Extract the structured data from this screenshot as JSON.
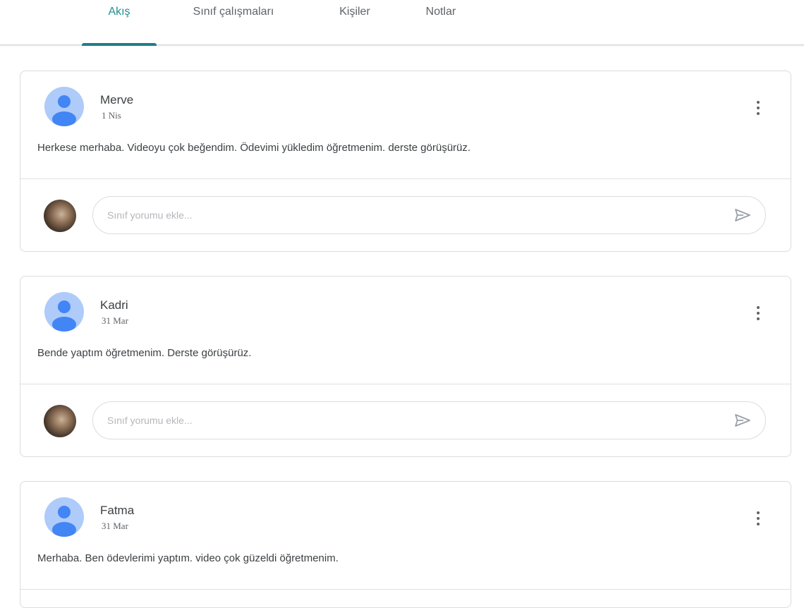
{
  "nav": {
    "tabs": [
      {
        "label": "Akış"
      },
      {
        "label": "Sınıf çalışmaları"
      },
      {
        "label": "Kişiler"
      },
      {
        "label": "Notlar"
      }
    ],
    "active_tab": "Akış",
    "accent_color": "#1e7f86"
  },
  "posts": [
    {
      "author": "Merve",
      "date": "1 Nis",
      "text": "Herkese merhaba. Videoyu çok beğendim. Ödevimi yükledim öğretmenim. derste görüşürüz.",
      "comment_placeholder": "Sınıf yorumu ekle..."
    },
    {
      "author": "Kadri",
      "date": "31 Mar",
      "text": "Bende yaptım öğretmenim. Derste görüşürüz.",
      "comment_placeholder": "Sınıf yorumu ekle..."
    },
    {
      "author": "Fatma",
      "date": "31 Mar",
      "text": "Merhaba. Ben ödevlerimi yaptım. video çok güzeldi öğretmenim."
    }
  ],
  "icons": {
    "default_avatar": "person-avatar-icon",
    "more": "more-vertical-icon",
    "send": "send-icon"
  }
}
